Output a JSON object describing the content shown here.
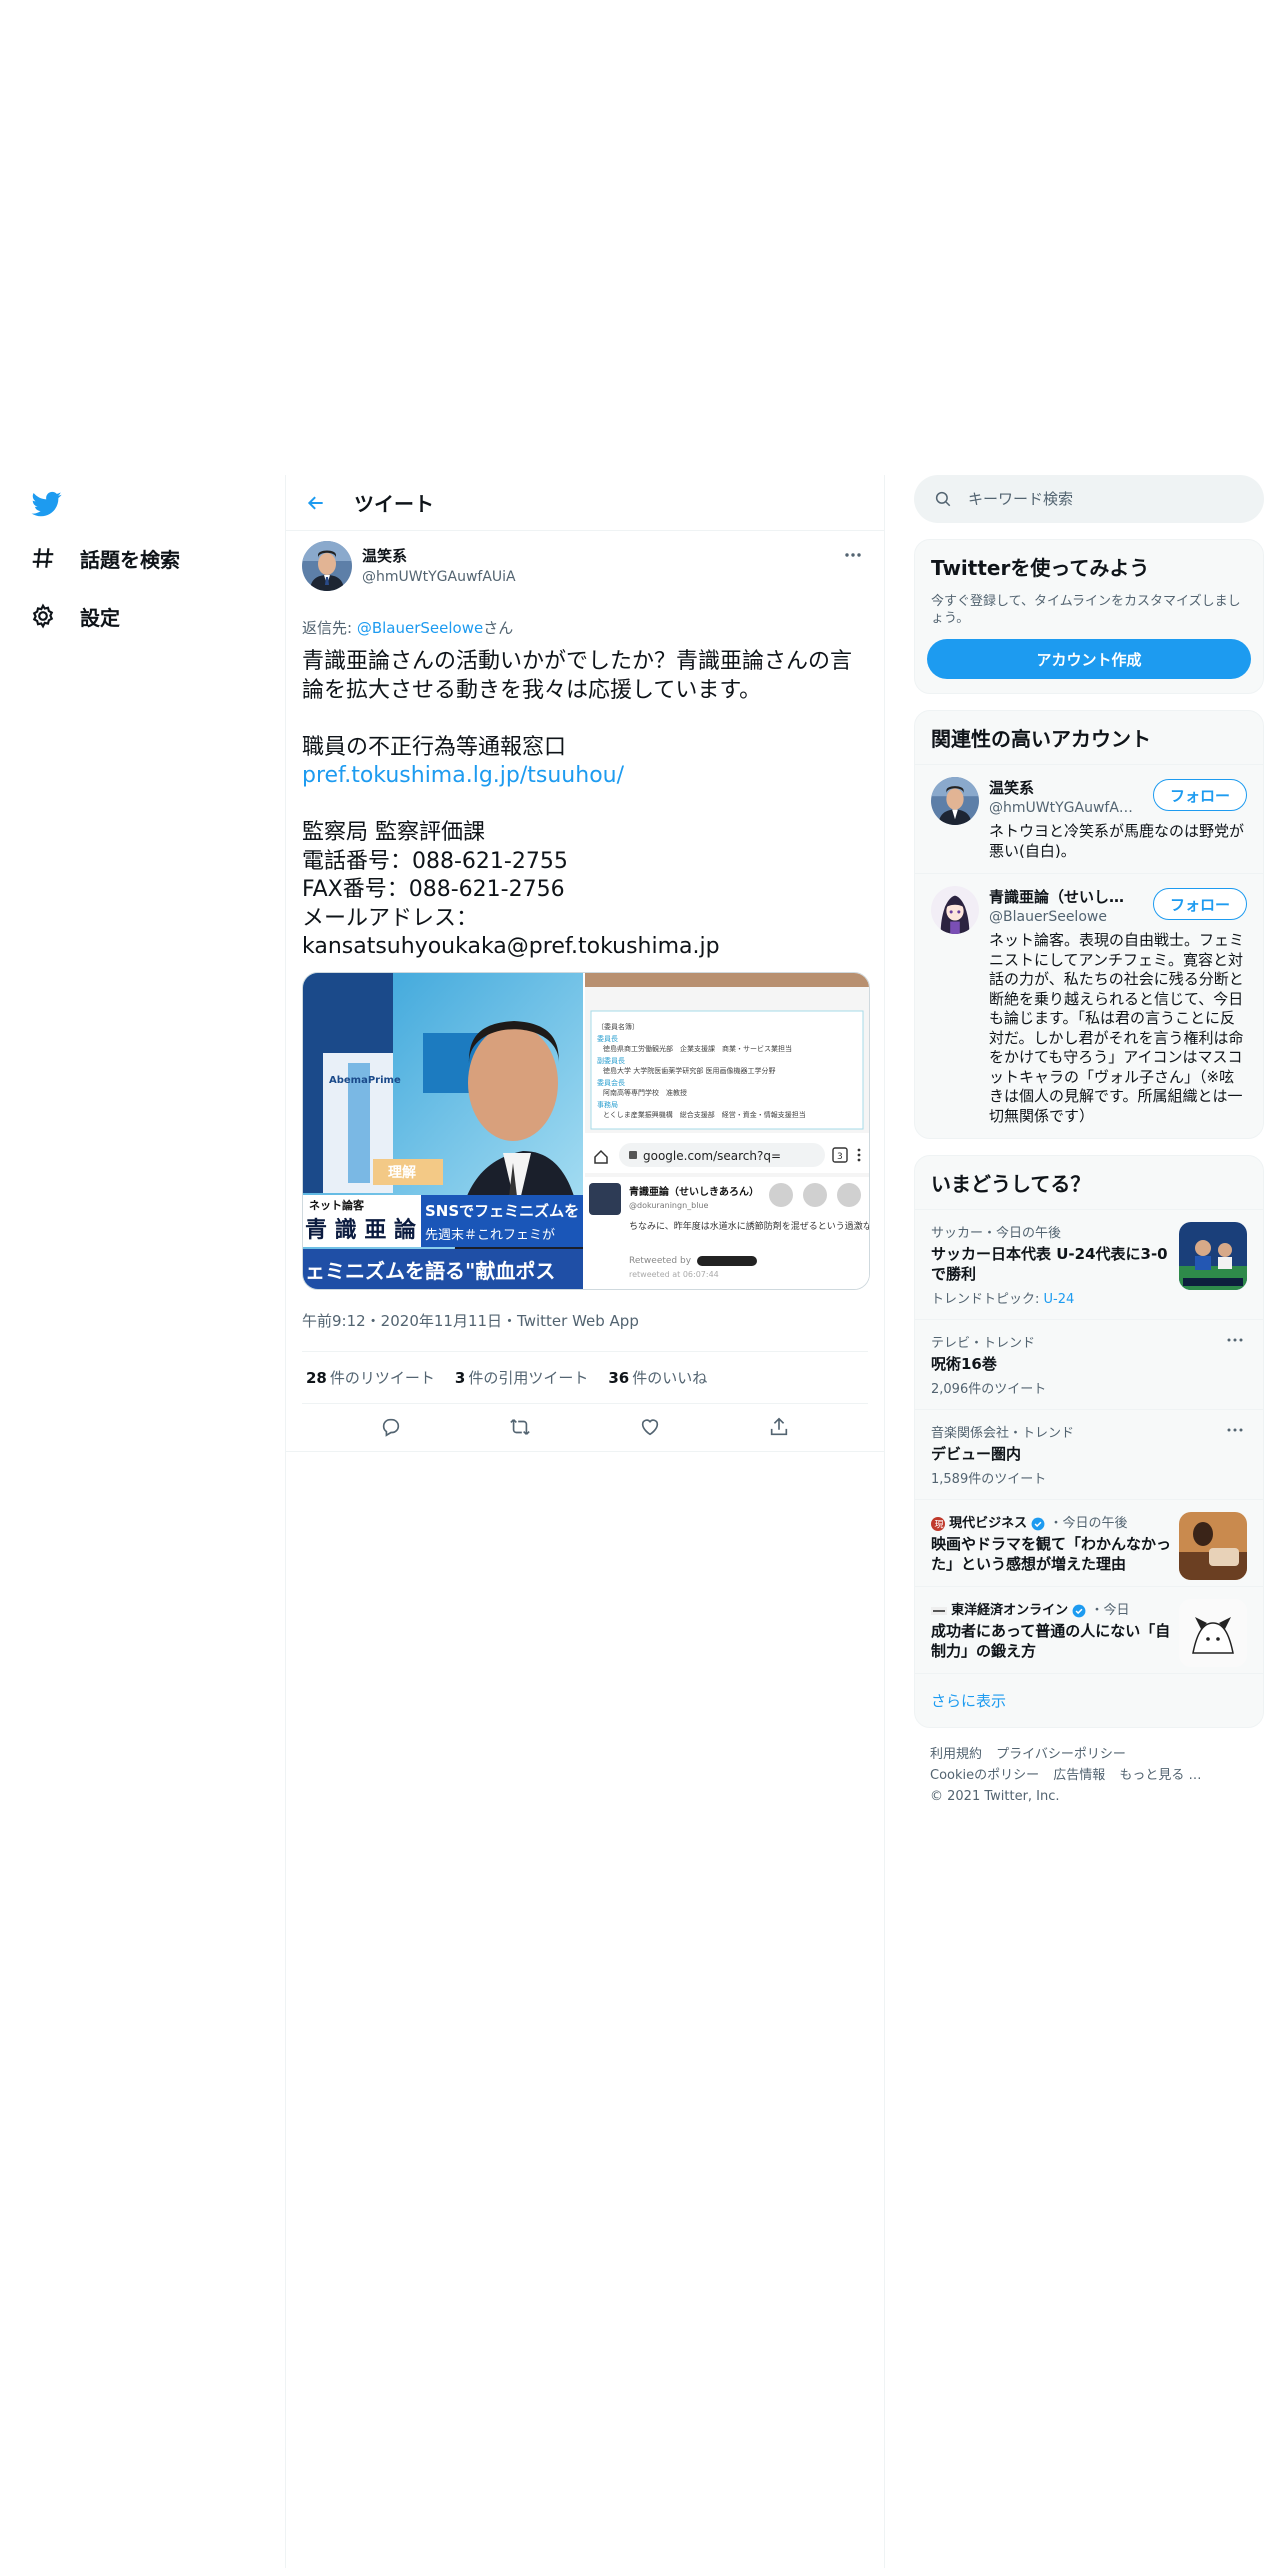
{
  "nav": {
    "explore_label": "話題を検索",
    "settings_label": "設定"
  },
  "header": {
    "title": "ツイート"
  },
  "tweet": {
    "author_name": "温笑系",
    "author_handle": "@hmUWtYGAuwfAUiA",
    "reply_prefix": "返信先: ",
    "reply_user": "@BlauerSeelowe",
    "reply_suffix": "さん",
    "text_1": "青識亜論さんの活動いかがでしたか？青識亜論さんの言論を拡大させる動きを我々は応援しています。\n\n職員の不正行為等通報窓口\n",
    "link": "pref.tokushima.lg.jp/tsuuhou/",
    "text_2": "\n\n監察局 監察評価課\n電話番号：088-621-2755\nFAX番号：088-621-2756\nメールアドレス：\nkansatsuhyoukaka@pref.tokushima.jp",
    "meta": "午前9:12・2020年11月11日・Twitter Web App",
    "retweets_count": "28",
    "retweets_label": "件のリツイート",
    "quotes_count": "3",
    "quotes_label": "件の引用ツイート",
    "likes_count": "36",
    "likes_label": "件のいいね",
    "media1": {
      "tv_caption_small": "ネット論客",
      "tv_caption_name": "青 識 亜 論",
      "tv_caption_right": "SNSでフェミニズムを",
      "tv_caption_right2": "先週末＃これフェミが",
      "tv_ticker": "ェミニズムを語る\"献血ポス",
      "tv_badge": "理解",
      "tv_logo": "AbemaPrime"
    },
    "media2": {
      "url_bar": "google.com/search?q=",
      "tab_count": "3",
      "quoted_name": "青識亜論（せいしきあろん）",
      "quoted_handle": "@dokuraningn_blue",
      "quoted_text": "ちなみに、昨年度は水道水に誘節防剤を混ぜるという過激な提案も飛び出して面白かったです。",
      "retweeted_by": "Retweeted by",
      "time": "retweeted at 06:07:44",
      "doc_lines": [
        "〔委員名簿〕",
        "委員長",
        "徳島県商工労働観光部　企業支援課　商業・サービス業担当",
        "副委員長",
        "徳島大学 大学院医歯薬学研究部 医用画像機器工学分野",
        "委員会長",
        "阿南高等専門学校　准教授",
        "事務局",
        "とくしま産業振興機構　総合支援部　経営・資金・情報支援担当"
      ]
    }
  },
  "search": {
    "placeholder": "キーワード検索"
  },
  "join_card": {
    "title": "Twitterを使ってみよう",
    "desc": "今すぐ登録して、タイムラインをカスタマイズしましょう。",
    "button": "アカウント作成"
  },
  "related": {
    "title": "関連性の高いアカウント",
    "follow_label": "フォロー",
    "accounts": [
      {
        "name": "温笑系",
        "handle": "@hmUWtYGAuwfAUiA",
        "bio": "ネトウヨと冷笑系が馬鹿なのは野党が悪い(自白)。"
      },
      {
        "name": "青識亜論（せいしきあろん）",
        "handle": "@BlauerSeelowe",
        "bio": "ネット論客。表現の自由戦士。フェミニストにしてアンチフェミ。寛容と対話の力が、私たちの社会に残る分断と断絶を乗り越えられると信じて、今日も論じます。「私は君の言うことに反対だ。しかし君がそれを言う権利は命をかけても守ろう」アイコンはマスコットキャラの「ヴォル子さん」（※呟きは個人の見解です。所属組織とは一切無関係です）"
      }
    ]
  },
  "trends": {
    "title": "いまどうしてる？",
    "items": [
      {
        "meta": "サッカー・今日の午後",
        "title": "サッカー日本代表 U-24代表に3-0で勝利",
        "count_prefix": "トレンドトピック: ",
        "count_link": "U-24"
      },
      {
        "meta": "テレビ・トレンド",
        "title": "呪術16巻",
        "count": "2,096件のツイート"
      },
      {
        "meta": "音楽関係会社・トレンド",
        "title": "デビュー圏内",
        "count": "1,589件のツイート"
      },
      {
        "source": "現代ビジネス",
        "meta_suffix": "・今日の午後",
        "title": "映画やドラマを観て「わかんなかった」という感想が増えた理由"
      },
      {
        "source": "東洋経済オンライン",
        "meta_suffix": "・今日",
        "title": "成功者にあって普通の人にない「自制力」の鍛え方"
      }
    ],
    "show_more": "さらに表示"
  },
  "footer": {
    "links": [
      "利用規約",
      "プライバシーポリシー",
      "Cookieのポリシー",
      "広告情報",
      "もっと見る …"
    ],
    "copyright": "© 2021 Twitter, Inc."
  },
  "colors": {
    "accent": "#1d9bf0",
    "text": "#0f1419",
    "secondary": "#536471",
    "border": "#eff3f4",
    "card_bg": "#f7f9f9"
  }
}
